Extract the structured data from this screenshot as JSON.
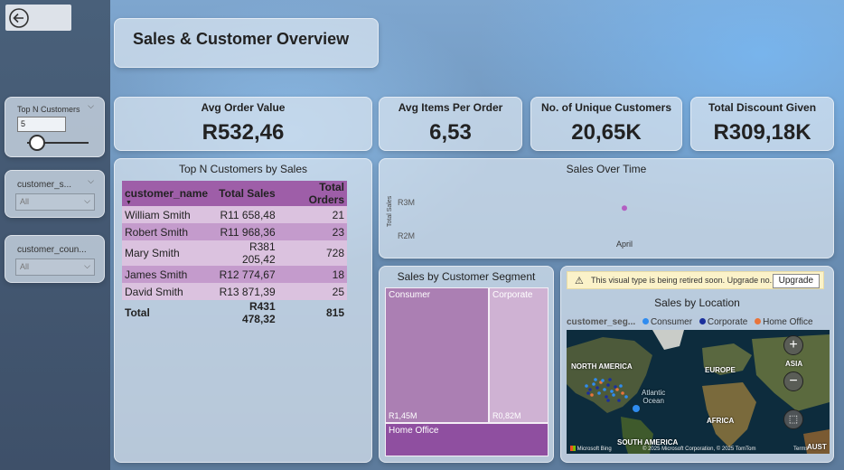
{
  "sidebar": {
    "back_icon": "back-arrow-icon",
    "top_n": {
      "title": "Top N Customers",
      "value": "5",
      "slider_fraction": 0.05
    },
    "customer_segment": {
      "title": "customer_s...",
      "value": "All"
    },
    "customer_country": {
      "title": "customer_coun...",
      "value": "All"
    }
  },
  "header": {
    "title": "Sales & Customer Overview"
  },
  "kpis": {
    "avg_order_value": {
      "label": "Avg Order Value",
      "value": "R532,46"
    },
    "avg_items": {
      "label": "Avg Items Per Order",
      "value": "6,53"
    },
    "unique_customers": {
      "label": "No. of Unique Customers",
      "value": "20,65K"
    },
    "total_discount": {
      "label": "Total Discount Given",
      "value": "R309,18K"
    }
  },
  "top_customers": {
    "title": "Top N Customers by Sales",
    "columns": [
      "customer_name",
      "Total Sales",
      "Total Orders"
    ],
    "rows": [
      {
        "name": "William Smith",
        "sales": "R11 658,48",
        "orders": "21"
      },
      {
        "name": "Robert Smith",
        "sales": "R11 968,36",
        "orders": "23"
      },
      {
        "name": "Mary Smith",
        "sales": "R381 205,42",
        "orders": "728"
      },
      {
        "name": "James Smith",
        "sales": "R12 774,67",
        "orders": "18"
      },
      {
        "name": "David Smith",
        "sales": "R13 871,39",
        "orders": "25"
      }
    ],
    "total": {
      "label": "Total",
      "sales": "R431 478,32",
      "orders": "815"
    }
  },
  "sales_over_time": {
    "title": "Sales Over Time",
    "ylabel": "Total Sales",
    "yticks": [
      "R3M",
      "R2M"
    ],
    "xtick": "April"
  },
  "segment": {
    "title": "Sales by Customer Segment",
    "cells": {
      "consumer": {
        "label": "Consumer",
        "value": "R1,45M"
      },
      "corporate": {
        "label": "Corporate",
        "value": "R0,82M"
      },
      "home_office": {
        "label": "Home Office"
      }
    }
  },
  "location": {
    "banner_text": "This visual type is being retired soon. Upgrade no...",
    "upgrade_label": "Upgrade",
    "title": "Sales by Location",
    "legend_title": "customer_seg...",
    "legend": [
      {
        "name": "Consumer",
        "color": "#2f8cf0"
      },
      {
        "name": "Corporate",
        "color": "#1a2f9c"
      },
      {
        "name": "Home Office",
        "color": "#e8743b"
      }
    ],
    "map_labels": {
      "north_america": "NORTH AMERICA",
      "europe": "EUROPE",
      "asia": "ASIA",
      "atlantic_1": "Atlantic",
      "atlantic_2": "Ocean",
      "africa": "AFRICA",
      "south_america": "SOUTH AMERICA",
      "aust": "AUST"
    },
    "zoom_in": "+",
    "zoom_out": "−",
    "bing_logo": "Microsoft Bing",
    "copyright": "© 2025 Microsoft Corporation, © 2025 TomTom",
    "terms": "Terms"
  },
  "chart_data": {
    "type": "line",
    "title": "Sales Over Time",
    "xlabel": "",
    "ylabel": "Total Sales",
    "x": [
      "April"
    ],
    "series": [
      {
        "values": [
          2600000
        ]
      }
    ],
    "ylim": [
      1800000,
      3200000
    ],
    "yticks": [
      "R3M",
      "R2M"
    ],
    "color": "#b35fc2"
  }
}
